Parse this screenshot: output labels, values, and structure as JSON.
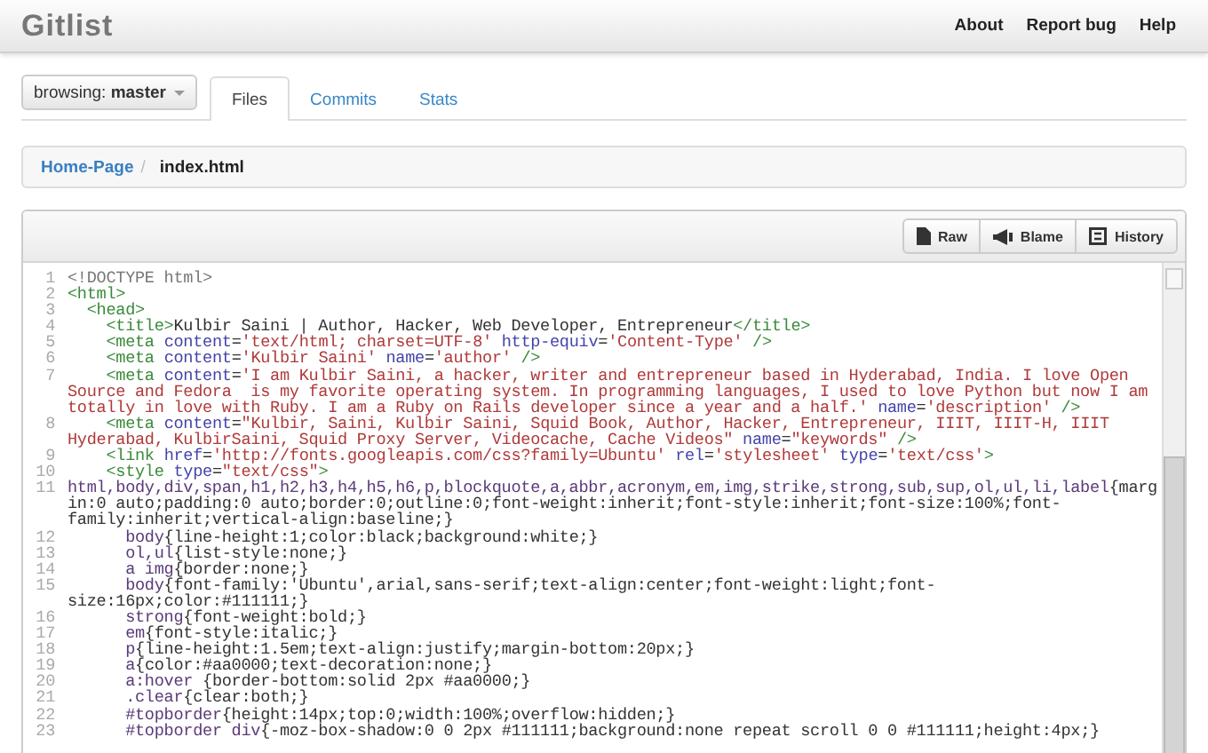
{
  "header": {
    "brand": "Gitlist",
    "nav": [
      "About",
      "Report bug",
      "Help"
    ]
  },
  "branch": {
    "label": "browsing:",
    "value": "master"
  },
  "tabs": [
    {
      "label": "Files",
      "selected": true
    },
    {
      "label": "Commits",
      "selected": false
    },
    {
      "label": "Stats",
      "selected": false
    }
  ],
  "breadcrumb": {
    "link": "Home-Page",
    "separator": "/",
    "current": "index.html"
  },
  "file_actions": [
    "Raw",
    "Blame",
    "History"
  ],
  "code_lines": [
    {
      "number": "1",
      "text": "<!DOCTYPE html>"
    },
    {
      "number": "2",
      "text": "<html>"
    },
    {
      "number": "3",
      "text": "  <head>"
    },
    {
      "number": "4",
      "text": "    <title>Kulbir Saini | Author, Hacker, Web Developer, Entrepreneur</title>"
    },
    {
      "number": "5",
      "text": "    <meta content='text/html; charset=UTF-8' http-equiv='Content-Type' />"
    },
    {
      "number": "6",
      "text": "    <meta content='Kulbir Saini' name='author' />"
    },
    {
      "number": "7",
      "text": "    <meta content='I am Kulbir Saini, a hacker, writer and entrepreneur based in Hyderabad, India. I love Open Source and Fedora  is my favorite operating system. In programming languages, I used to love Python but now I am totally in love with Ruby. I am a Ruby on Rails developer since a year and a half.' name='description' />"
    },
    {
      "number": "8",
      "text": "    <meta content=\"Kulbir, Saini, Kulbir Saini, Squid Book, Author, Hacker, Entrepreneur, IIIT, IIIT-H, IIIT Hyderabad, KulbirSaini, Squid Proxy Server, Videocache, Cache Videos\" name=\"keywords\" />"
    },
    {
      "number": "9",
      "text": "    <link href='http://fonts.googleapis.com/css?family=Ubuntu' rel='stylesheet' type='text/css'>"
    },
    {
      "number": "10",
      "text": "    <style type=\"text/css\">"
    },
    {
      "number": "11",
      "text": "html,body,div,span,h1,h2,h3,h4,h5,h6,p,blockquote,a,abbr,acronym,em,img,strike,strong,sub,sup,ol,ul,li,label{margin:0 auto;padding:0 auto;border:0;outline:0;font-weight:inherit;font-style:inherit;font-size:100%;font-family:inherit;vertical-align:baseline;}"
    },
    {
      "number": "12",
      "text": "      body{line-height:1;color:black;background:white;}"
    },
    {
      "number": "13",
      "text": "      ol,ul{list-style:none;}"
    },
    {
      "number": "14",
      "text": "      a img{border:none;}"
    },
    {
      "number": "15",
      "text": "      body{font-family:'Ubuntu',arial,sans-serif;text-align:center;font-weight:light;font-size:16px;color:#111111;}"
    },
    {
      "number": "16",
      "text": "      strong{font-weight:bold;}"
    },
    {
      "number": "17",
      "text": "      em{font-style:italic;}"
    },
    {
      "number": "18",
      "text": "      p{line-height:1.5em;text-align:justify;margin-bottom:20px;}"
    },
    {
      "number": "19",
      "text": "      a{color:#aa0000;text-decoration:none;}"
    },
    {
      "number": "20",
      "text": "      a:hover {border-bottom:solid 2px #aa0000;}"
    },
    {
      "number": "21",
      "text": "      .clear{clear:both;}"
    },
    {
      "number": "22",
      "text": "      #topborder{height:14px;top:0;width:100%;overflow:hidden;}"
    },
    {
      "number": "23",
      "text": "      #topborder div{-moz-box-shadow:0 0 2px #111111;background:none repeat scroll 0 0 #111111;height:4px;}"
    }
  ]
}
